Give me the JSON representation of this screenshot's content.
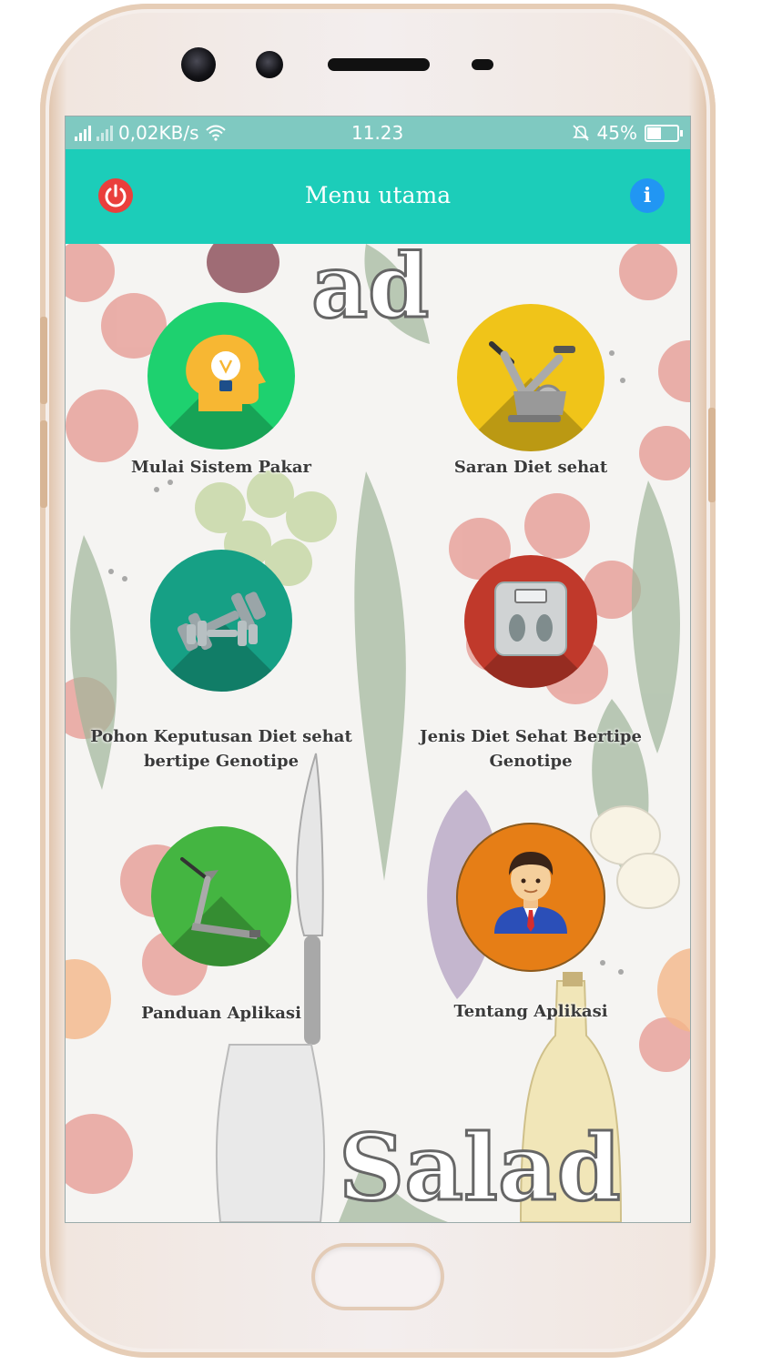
{
  "status_bar": {
    "network_speed": "0,02KB/s",
    "time": "11.23",
    "battery_percent": "45%",
    "battery_level": 0.45
  },
  "app_bar": {
    "title": "Menu utama"
  },
  "background": {
    "word_top": "ad",
    "word_bottom": "Salad"
  },
  "menu": {
    "items": [
      {
        "label": "Mulai Sistem Pakar",
        "color": "#1ed16f",
        "icon": "head-lightbulb-icon"
      },
      {
        "label": "Saran Diet sehat",
        "color": "#f0c419",
        "icon": "exercise-bike-icon"
      },
      {
        "label": "Pohon Keputusan Diet sehat bertipe Genotipe",
        "color": "#16a085",
        "icon": "dumbbell-icon"
      },
      {
        "label": "Jenis Diet Sehat Bertipe Genotipe",
        "color": "#c0392b",
        "icon": "weighing-scale-icon"
      },
      {
        "label": "Panduan Aplikasi",
        "color": "#44b541",
        "icon": "treadmill-icon"
      },
      {
        "label": "Tentang Aplikasi",
        "color": "#e67e16",
        "icon": "businessman-avatar-icon"
      }
    ]
  }
}
